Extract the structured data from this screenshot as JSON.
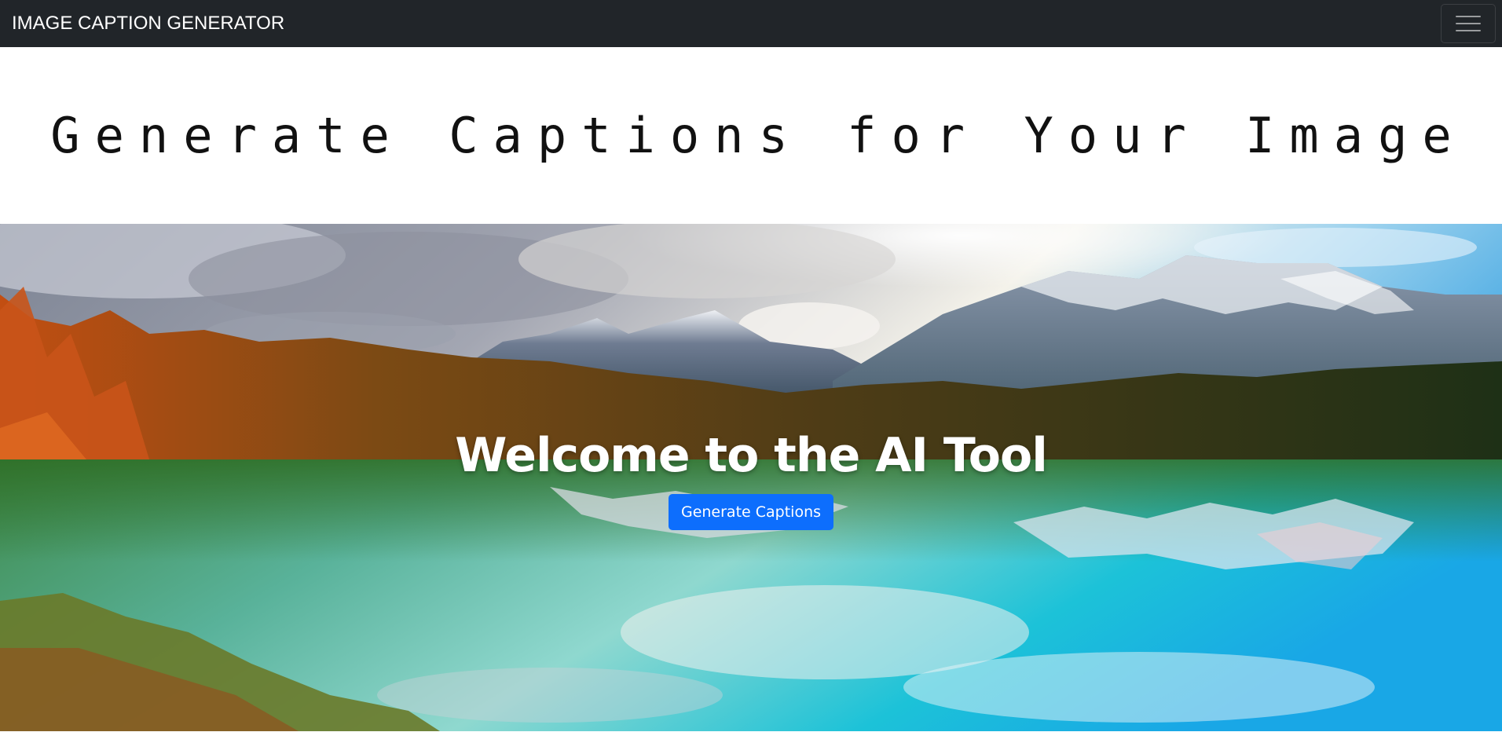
{
  "navbar": {
    "brand": "IMAGE CAPTION GENERATOR",
    "toggler_icon": "hamburger-menu-icon",
    "background": "#212529"
  },
  "page": {
    "title": "Generate Captions for Your Image"
  },
  "hero": {
    "image": "mountain-lake-landscape",
    "title": "Welcome to the AI Tool",
    "button_label": "Generate Captions",
    "button_color": "#0d6efd"
  }
}
